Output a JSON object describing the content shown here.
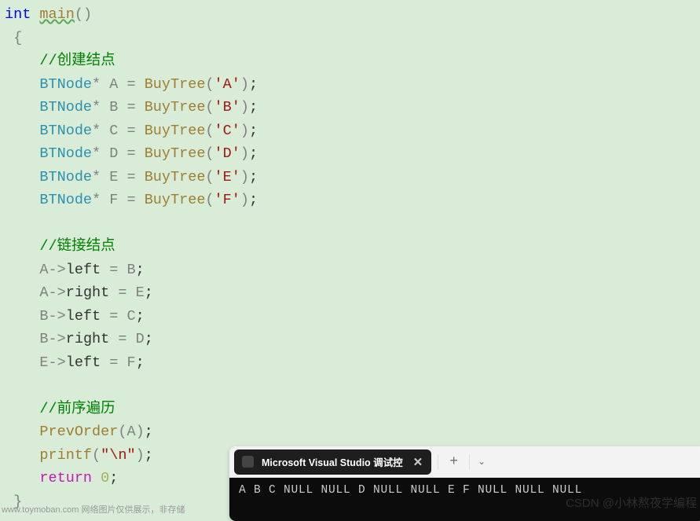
{
  "code": {
    "line1": {
      "type": "int",
      "func": "main",
      "parens": "()"
    },
    "line2": "{",
    "comment1": "    //创建结点",
    "decl": [
      {
        "type": "BTNode",
        "star": "*",
        "var": "A",
        "eq": "=",
        "fn": "BuyTree",
        "open": "(",
        "lit": "'A'",
        "close": ")",
        "semi": ";"
      },
      {
        "type": "BTNode",
        "star": "*",
        "var": "B",
        "eq": "=",
        "fn": "BuyTree",
        "open": "(",
        "lit": "'B'",
        "close": ")",
        "semi": ";"
      },
      {
        "type": "BTNode",
        "star": "*",
        "var": "C",
        "eq": "=",
        "fn": "BuyTree",
        "open": "(",
        "lit": "'C'",
        "close": ")",
        "semi": ";"
      },
      {
        "type": "BTNode",
        "star": "*",
        "var": "D",
        "eq": "=",
        "fn": "BuyTree",
        "open": "(",
        "lit": "'D'",
        "close": ")",
        "semi": ";"
      },
      {
        "type": "BTNode",
        "star": "*",
        "var": "E",
        "eq": "=",
        "fn": "BuyTree",
        "open": "(",
        "lit": "'E'",
        "close": ")",
        "semi": ";"
      },
      {
        "type": "BTNode",
        "star": "*",
        "var": "F",
        "eq": "=",
        "fn": "BuyTree",
        "open": "(",
        "lit": "'F'",
        "close": ")",
        "semi": ";"
      }
    ],
    "comment2": "    //链接结点",
    "link": [
      {
        "v": "A",
        "arrow": "->",
        "mem": "left",
        "eq": " = ",
        "val": "B",
        "semi": ";"
      },
      {
        "v": "A",
        "arrow": "->",
        "mem": "right",
        "eq": " = ",
        "val": "E",
        "semi": ";"
      },
      {
        "v": "B",
        "arrow": "->",
        "mem": "left",
        "eq": " = ",
        "val": "C",
        "semi": ";"
      },
      {
        "v": "B",
        "arrow": "->",
        "mem": "right",
        "eq": " = ",
        "val": "D",
        "semi": ";"
      },
      {
        "v": "E",
        "arrow": "->",
        "mem": "left",
        "eq": " = ",
        "val": "F",
        "semi": ";"
      }
    ],
    "comment3": "    //前序遍历",
    "prev": {
      "fn": "PrevOrder",
      "open": "(",
      "arg": "A",
      "close": ")",
      "semi": ";"
    },
    "printf": {
      "fn": "printf",
      "open": "(",
      "lit": "\"\\n\"",
      "close": ")",
      "semi": ";"
    },
    "ret": {
      "kw": "return",
      "sp": " ",
      "val": "0",
      "semi": ";"
    },
    "close": "}"
  },
  "console": {
    "tabTitle": "Microsoft Visual Studio 调试控",
    "add": "+",
    "chevron": "⌄",
    "close": "✕",
    "output": "A  B  C  NULL  NULL  D  NULL  NULL  E  F  NULL  NULL  NULL"
  },
  "watermarks": {
    "left": "www.toymoban.com 网络图片仅供展示，非存储",
    "right": "CSDN @小林熬夜学编程"
  }
}
